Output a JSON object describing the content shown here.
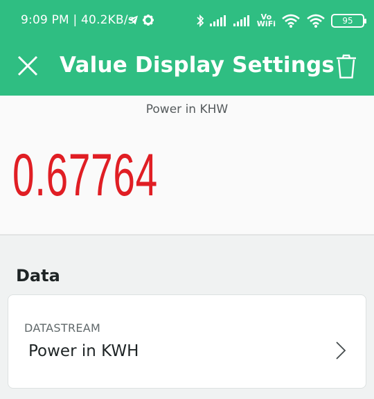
{
  "status_bar": {
    "time": "9:09 PM | 40.2KB/s",
    "vowifi_top": "Vo",
    "vowifi_bottom": "WiFi",
    "battery": "95"
  },
  "appbar": {
    "title": "Value Display Settings"
  },
  "preview": {
    "label": "Power in KHW",
    "value": "0.67764",
    "value_color": "#e01e24"
  },
  "data_section": {
    "title": "Data",
    "datastream_label": "DATASTREAM",
    "datastream_value": "Power in KWH"
  },
  "colors": {
    "header": "#2fbe82"
  }
}
